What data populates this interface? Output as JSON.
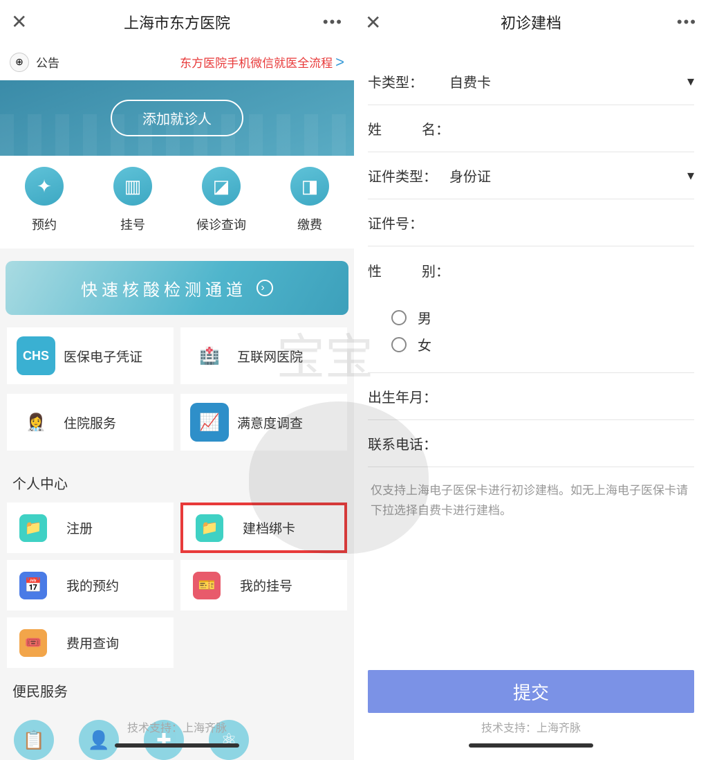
{
  "left": {
    "header": {
      "title": "上海市东方医院",
      "close": "✕",
      "more": "•••"
    },
    "announce": {
      "label": "公告",
      "link": "东方医院手机微信就医全流程",
      "arrow": ">"
    },
    "hero_button": "添加就诊人",
    "quick": [
      {
        "label": "预约"
      },
      {
        "label": "挂号"
      },
      {
        "label": "候诊查询"
      },
      {
        "label": "缴费"
      }
    ],
    "banner": "快速核酸检测通道",
    "services": [
      {
        "label": "医保电子凭证",
        "badge": "CHS"
      },
      {
        "label": "互联网医院"
      },
      {
        "label": "住院服务"
      },
      {
        "label": "满意度调查"
      }
    ],
    "personal_title": "个人中心",
    "personal": [
      {
        "label": "注册",
        "color": "#3fd1c4",
        "highlight": false
      },
      {
        "label": "建档绑卡",
        "color": "#3fd1c4",
        "highlight": true
      },
      {
        "label": "我的预约",
        "color": "#4a7be6",
        "highlight": false
      },
      {
        "label": "我的挂号",
        "color": "#e85a6b",
        "highlight": false
      },
      {
        "label": "费用查询",
        "color": "#f2a54a",
        "highlight": false
      }
    ],
    "convenience_title": "便民服务",
    "footer": "技术支持：上海齐脉"
  },
  "right": {
    "header": {
      "title": "初诊建档",
      "close": "✕",
      "more": "•••"
    },
    "fields": {
      "card_type_label": "卡类型：",
      "card_type_value": "自费卡",
      "name_label_a": "姓",
      "name_label_b": "名：",
      "id_type_label": "证件类型：",
      "id_type_value": "身份证",
      "id_no_label": "证件号：",
      "gender_label_a": "性",
      "gender_label_b": "别：",
      "gender_male": "男",
      "gender_female": "女",
      "dob_label": "出生年月：",
      "phone_label": "联系电话："
    },
    "hint": "仅支持上海电子医保卡进行初诊建档。如无上海电子医保卡请下拉选择自费卡进行建档。",
    "submit": "提交",
    "footer": "技术支持：上海齐脉"
  }
}
